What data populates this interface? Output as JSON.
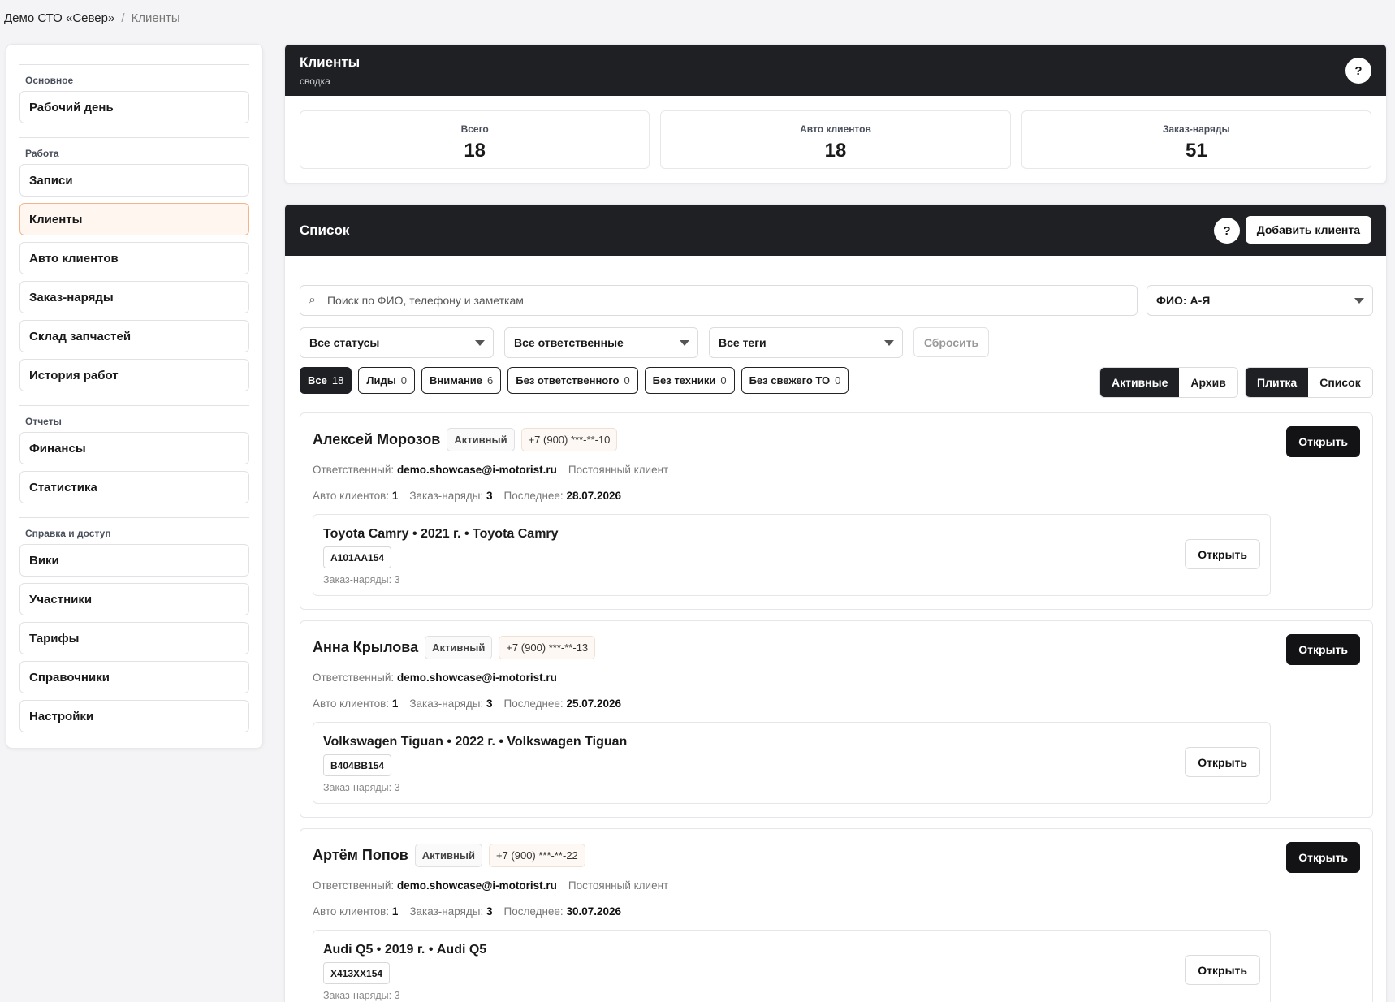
{
  "breadcrumb": {
    "root": "Демо СТО «Север»",
    "separator": "/",
    "current": "Клиенты"
  },
  "sidebar": {
    "groups": [
      {
        "title": "Основное",
        "items": [
          "Рабочий день"
        ]
      },
      {
        "title": "Работа",
        "items": [
          "Записи",
          "Клиенты",
          "Авто клиентов",
          "Заказ-наряды",
          "Склад запчастей",
          "История работ"
        ]
      },
      {
        "title": "Отчеты",
        "items": [
          "Финансы",
          "Статистика"
        ]
      },
      {
        "title": "Справка и доступ",
        "items": [
          "Вики",
          "Участники",
          "Тарифы",
          "Справочники",
          "Настройки"
        ]
      }
    ],
    "active_item": "Клиенты"
  },
  "summary": {
    "title": "Клиенты",
    "subtitle": "сводка",
    "help": "?",
    "stats": [
      {
        "label": "Всего",
        "value": "18"
      },
      {
        "label": "Авто клиентов",
        "value": "18"
      },
      {
        "label": "Заказ-наряды",
        "value": "51"
      }
    ]
  },
  "list": {
    "title": "Список",
    "help": "?",
    "add_button": "Добавить клиента",
    "search_placeholder": "Поиск по ФИО, телефону и заметкам",
    "search_icon": "⌕",
    "sort": "ФИО: А-Я",
    "filters": {
      "status": "Все статусы",
      "responsible": "Все ответственные",
      "tags": "Все теги"
    },
    "reset": "Сбросить",
    "chips": [
      {
        "label": "Все",
        "count": "18"
      },
      {
        "label": "Лиды",
        "count": "0"
      },
      {
        "label": "Внимание",
        "count": "6"
      },
      {
        "label": "Без ответственного",
        "count": "0"
      },
      {
        "label": "Без техники",
        "count": "0"
      },
      {
        "label": "Без свежего ТО",
        "count": "0"
      }
    ],
    "scope": {
      "active": "Активные",
      "archive": "Архив"
    },
    "view": {
      "tile": "Плитка",
      "list": "Список"
    }
  },
  "clients": [
    {
      "name": "Алексей Морозов",
      "status": "Активный",
      "phone": "+7 (900) ***-**-10",
      "responsible_label": "Ответственный:",
      "responsible": "demo.showcase@i-motorist.ru",
      "tag": "Постоянный клиент",
      "cars_label": "Авто клиентов:",
      "cars": "1",
      "orders_label": "Заказ-наряды:",
      "orders": "3",
      "last_label": "Последнее:",
      "last": "28.07.2026",
      "open": "Открыть",
      "car": {
        "title": "Toyota Camry • 2021 г. • Toyota Camry",
        "plate": "А101АА154",
        "orders": "Заказ-наряды: 3",
        "open": "Открыть"
      }
    },
    {
      "name": "Анна Крылова",
      "status": "Активный",
      "phone": "+7 (900) ***-**-13",
      "responsible_label": "Ответственный:",
      "responsible": "demo.showcase@i-motorist.ru",
      "tag": "",
      "cars_label": "Авто клиентов:",
      "cars": "1",
      "orders_label": "Заказ-наряды:",
      "orders": "3",
      "last_label": "Последнее:",
      "last": "25.07.2026",
      "open": "Открыть",
      "car": {
        "title": "Volkswagen Tiguan • 2022 г. • Volkswagen Tiguan",
        "plate": "В404ВВ154",
        "orders": "Заказ-наряды: 3",
        "open": "Открыть"
      }
    },
    {
      "name": "Артём Попов",
      "status": "Активный",
      "phone": "+7 (900) ***-**-22",
      "responsible_label": "Ответственный:",
      "responsible": "demo.showcase@i-motorist.ru",
      "tag": "Постоянный клиент",
      "cars_label": "Авто клиентов:",
      "cars": "1",
      "orders_label": "Заказ-наряды:",
      "orders": "3",
      "last_label": "Последнее:",
      "last": "30.07.2026",
      "open": "Открыть",
      "car": {
        "title": "Audi Q5 • 2019 г. • Audi Q5",
        "plate": "Х413ХХ154",
        "orders": "Заказ-наряды: 3",
        "open": "Открыть"
      }
    }
  ]
}
